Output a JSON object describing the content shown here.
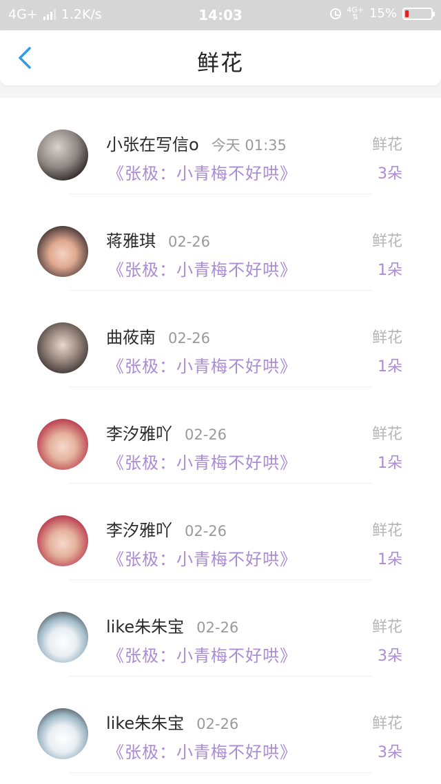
{
  "status_bar": {
    "network": "4G+",
    "speed": "1.2K/s",
    "time": "14:03",
    "net_badge": "4G+",
    "battery": "15%",
    "battery_level": 0.15
  },
  "header": {
    "title": "鲜花"
  },
  "colors": {
    "accent_purple": "#a98bd6",
    "back_blue": "#2f9be8"
  },
  "records": [
    {
      "name": "小张在写信o",
      "time": "今天 01:35",
      "book": "《张极：小青梅不好哄》",
      "gift": "鲜花",
      "count": "3朵"
    },
    {
      "name": "蒋雅琪",
      "time": "02-26",
      "book": "《张极：小青梅不好哄》",
      "gift": "鲜花",
      "count": "1朵"
    },
    {
      "name": "曲莜南",
      "time": "02-26",
      "book": "《张极：小青梅不好哄》",
      "gift": "鲜花",
      "count": "1朵"
    },
    {
      "name": "李汐雅吖",
      "time": "02-26",
      "book": "《张极：小青梅不好哄》",
      "gift": "鲜花",
      "count": "1朵"
    },
    {
      "name": "李汐雅吖",
      "time": "02-26",
      "book": "《张极：小青梅不好哄》",
      "gift": "鲜花",
      "count": "1朵"
    },
    {
      "name": "like朱朱宝",
      "time": "02-26",
      "book": "《张极：小青梅不好哄》",
      "gift": "鲜花",
      "count": "3朵"
    },
    {
      "name": "like朱朱宝",
      "time": "02-26",
      "book": "《张极：小青梅不好哄》",
      "gift": "鲜花",
      "count": "3朵"
    }
  ]
}
